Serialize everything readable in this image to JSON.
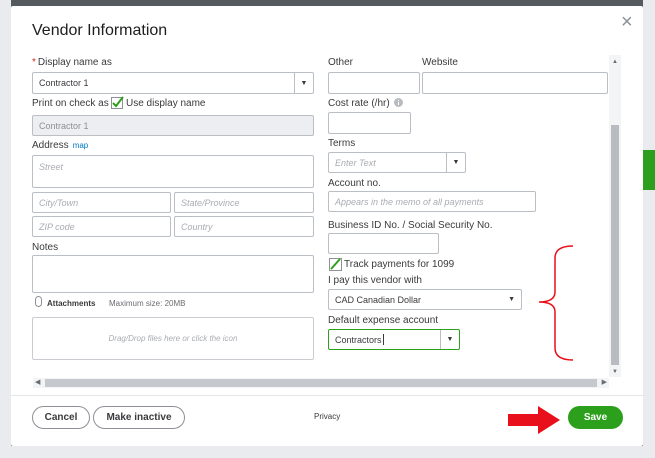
{
  "dialog": {
    "title": "Vendor Information",
    "close_glyph": "×"
  },
  "left": {
    "display_name_label": "Display name as",
    "required_mark": "*",
    "display_name_value": "Contractor 1",
    "print_on_check_label": "Print on check as",
    "use_display_name_label": "Use display name",
    "print_on_check_value": "Contractor 1",
    "address_label": "Address",
    "map_link": "map",
    "street_placeholder": "Street",
    "city_placeholder": "City/Town",
    "state_placeholder": "State/Province",
    "zip_placeholder": "ZIP code",
    "country_placeholder": "Country",
    "notes_label": "Notes",
    "attachments_label": "Attachments",
    "max_size_text": "Maximum size: 20MB",
    "dropzone_text": "Drag/Drop files here or click the icon"
  },
  "right": {
    "other_label": "Other",
    "website_label": "Website",
    "cost_rate_label": "Cost rate (/hr)",
    "terms_label": "Terms",
    "terms_placeholder": "Enter Text",
    "account_no_label": "Account no.",
    "account_no_placeholder": "Appears in the memo of all payments",
    "business_id_label": "Business ID No. / Social Security No.",
    "track_1099_label": "Track payments for 1099",
    "currency_label": "I pay this vendor with",
    "currency_value": "CAD Canadian Dollar",
    "expense_account_label": "Default expense account",
    "expense_account_value": "Contractors"
  },
  "footer": {
    "cancel_label": "Cancel",
    "make_inactive_label": "Make inactive",
    "privacy_label": "Privacy",
    "save_label": "Save"
  },
  "colors": {
    "accent_green": "#2ca01c",
    "annotation_red": "#e8101a",
    "link_blue": "#0077c5"
  },
  "icons": {
    "info": "info-circle-icon",
    "attachment": "paperclip-icon",
    "dropdown": "caret-down-icon",
    "check": "checkmark-icon"
  }
}
